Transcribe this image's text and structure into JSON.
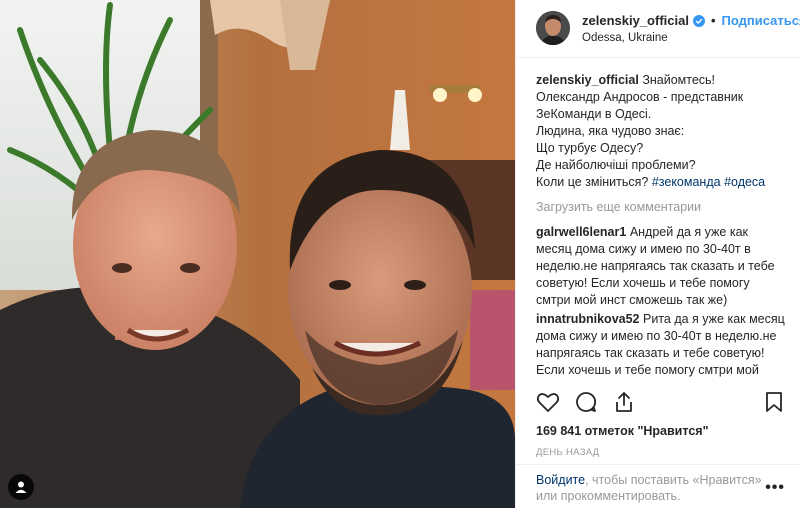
{
  "header": {
    "username": "zelenskiy_official",
    "follow_label": "Подписаться",
    "location": "Odessa, Ukraine",
    "verified_icon": "verified-badge-icon"
  },
  "caption": {
    "username": "zelenskiy_official",
    "text": "Знайомтесь!\nОлександр Андросов - представник ЗеКоманди в Одесі.\nЛюдина, яка чудово знає:\nЩо турбує Одесу?\nДе найболючіші проблеми?\nКоли це зміниться? ",
    "hashtags": [
      "#зекоманда",
      "#одеса"
    ]
  },
  "load_more": "Загрузить еще комментарии",
  "comments": [
    {
      "username": "galrwell6lenar1",
      "text": "Андрей да я уже как месяц дома сижу и имею по 30-40т в неделю.не напрягаясь так сказать и тебе советую! Если хочешь и тебе помогу смтри мой инст сможешь так же)"
    },
    {
      "username": "innatrubnikova52",
      "text": "Рита да я уже как месяц дома сижу и имею по 30-40т в неделю.не напрягаясь так сказать и тебе советую! Если хочешь и тебе помогу смтри мой инст сможешь так же)"
    }
  ],
  "actions": {
    "like_icon": "heart-icon",
    "comment_icon": "comment-icon",
    "share_icon": "share-icon",
    "save_icon": "bookmark-icon"
  },
  "likes": "169 841 отметок \"Нравится\"",
  "time": "ДЕНЬ НАЗАД",
  "footer": {
    "login_link": "Войдите",
    "login_rest": ", чтобы поставить «Нравится» или прокомментировать.",
    "more": "•••"
  },
  "colors": {
    "link_blue": "#3897f0",
    "hashtag": "#003569",
    "muted": "#999999"
  }
}
